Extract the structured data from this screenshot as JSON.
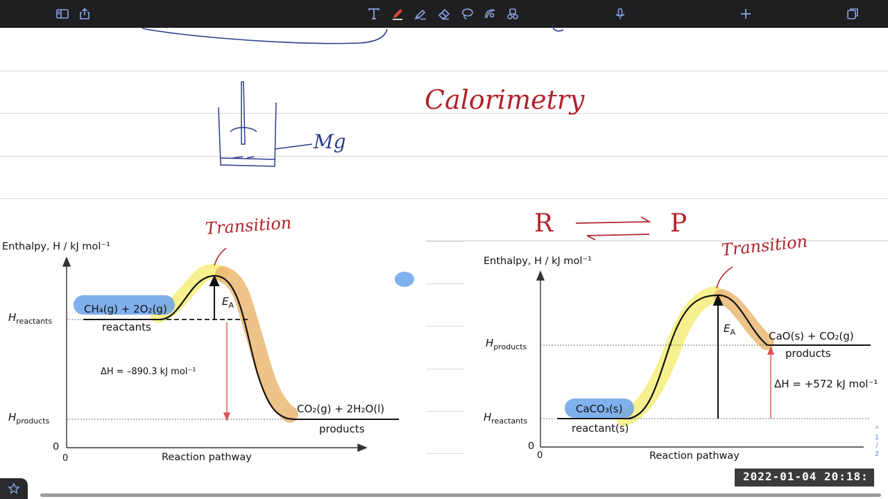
{
  "toolbar": {
    "left": [
      "sidebar-icon",
      "share-icon"
    ],
    "center": [
      "text-tool-icon",
      "pen-tool-icon",
      "highlighter-tool-icon",
      "eraser-tool-icon",
      "lasso-tool-icon",
      "image-tool-icon",
      "shapes-tool-icon"
    ],
    "right": [
      "microphone-icon",
      "add-page-icon",
      "pages-icon"
    ],
    "accent": "#e0473c"
  },
  "handwriting": {
    "heading": "Calorimetry",
    "metal": "Mg",
    "transition_left": "Transition",
    "transition_right": "Transition",
    "equilibrium_reactant": "R",
    "equilibrium_product": "P"
  },
  "diagram_exothermic": {
    "y_axis": "Enthalpy, H / kJ mol⁻¹",
    "x_axis": "Reaction pathway",
    "origin": "0",
    "h_reactants": "H",
    "h_reactants_sub": "reactants",
    "h_products": "H",
    "h_products_sub": "products",
    "reactants_formula": "CH₄(g) + 2O₂(g)",
    "reactants_label": "reactants",
    "products_formula": "CO₂(g) + 2H₂O(l)",
    "products_label": "products",
    "activation": "E",
    "activation_sub": "A",
    "delta_h": "ΔH = –890.3 kJ mol⁻¹"
  },
  "diagram_endothermic": {
    "y_axis": "Enthalpy, H / kJ mol⁻¹",
    "x_axis": "Reaction pathway",
    "origin": "0",
    "h_products": "H",
    "h_products_sub": "products",
    "h_reactants": "H",
    "h_reactants_sub": "reactants",
    "products_formula": "CaO(s) + CO₂(g)",
    "products_label": "products",
    "reactants_formula": "CaCO₃(s)",
    "reactants_label": "reactant(s)",
    "activation": "E",
    "activation_sub": "A",
    "delta_h": "ΔH = +572 kJ mol⁻¹"
  },
  "status": {
    "timestamp": "2022-01-04 20:18:",
    "page_up": "^",
    "page_current": "1",
    "page_sep": "/",
    "page_total": "2"
  },
  "colors": {
    "toolbar_bg": "#1f1f21",
    "ink_blue": "#2b3a8c",
    "ink_red": "#b2222a",
    "highlight_yellow": "#f5ef7a",
    "highlight_orange": "#e8b46b",
    "highlight_blue": "#6aa3ea"
  }
}
